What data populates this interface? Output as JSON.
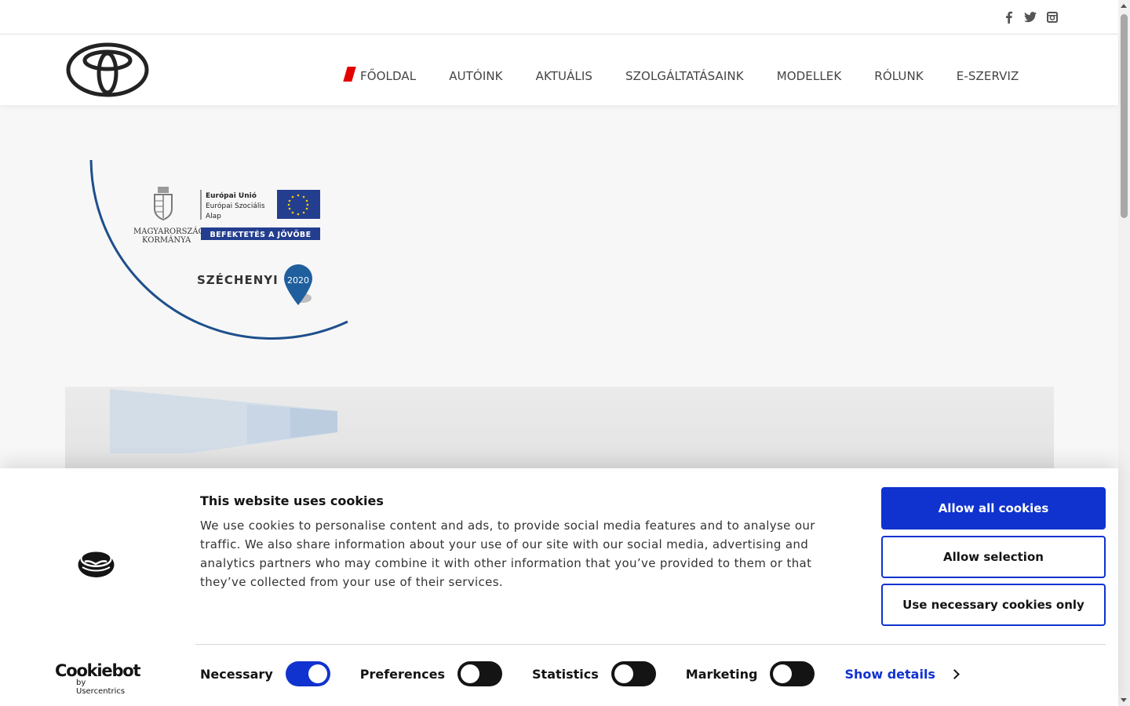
{
  "social": {
    "icons": [
      "facebook-icon",
      "twitter-icon",
      "instagram-icon"
    ]
  },
  "header": {
    "brand": "toyota-logo",
    "nav": [
      {
        "label": "FŐOLDAL",
        "active": true
      },
      {
        "label": "AUTÓINK"
      },
      {
        "label": "AKTUÁLIS"
      },
      {
        "label": "SZOLGÁLTATÁSAINK"
      },
      {
        "label": "MODELLEK"
      },
      {
        "label": "RÓLUNK"
      },
      {
        "label": "E-SZERVIZ"
      }
    ]
  },
  "badge": {
    "gov_line1": "MAGYARORSZÁG",
    "gov_line2": "KORMÁNYA",
    "eu_line1": "Európai Unió",
    "eu_line2": "Európai Szociális",
    "eu_line3": "Alap",
    "invest": "BEFEKTETÉS A JÖVŐBE",
    "program": "SZÉCHENYI",
    "year": "2020"
  },
  "cookie": {
    "title": "This website uses cookies",
    "text": "We use cookies to personalise content and ads, to provide social media features and to analyse our traffic. We also share information about your use of our site with our social media, advertising and analytics partners who may combine it with other information that you’ve provided to them or that they’ve collected from your use of their services.",
    "buttons": {
      "allow_all": "Allow all cookies",
      "allow_selection": "Allow selection",
      "necessary_only": "Use necessary cookies only"
    },
    "toggles": [
      {
        "label": "Necessary",
        "on": true
      },
      {
        "label": "Preferences",
        "on": false
      },
      {
        "label": "Statistics",
        "on": false
      },
      {
        "label": "Marketing",
        "on": false
      }
    ],
    "show_details": "Show details",
    "logo_main": "Cookiebot",
    "logo_sub": "by Usercentrics"
  },
  "colors": {
    "accent_blue": "#1032cf",
    "toyota_red": "#e50000",
    "badge_blue": "#1e4f8c"
  }
}
